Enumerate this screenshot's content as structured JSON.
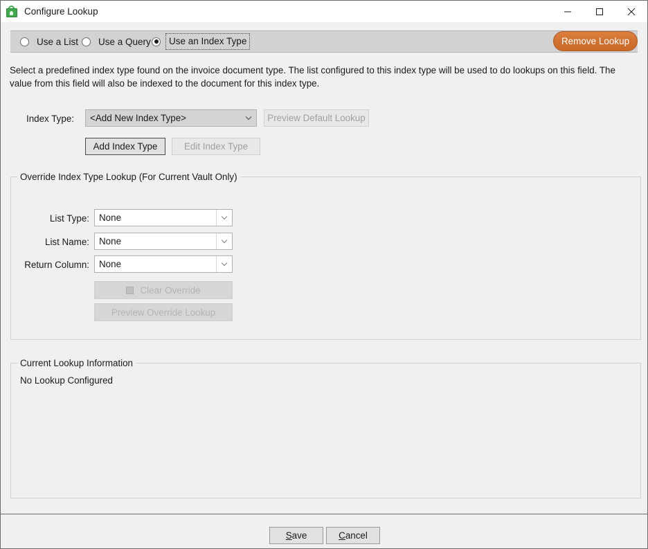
{
  "window": {
    "title": "Configure Lookup",
    "icon": "green-lock-icon",
    "controls": {
      "minimize": "minimize-icon",
      "maximize": "maximize-icon",
      "close": "close-icon"
    }
  },
  "mode_selector": {
    "options": [
      {
        "label": "Use a List",
        "selected": false,
        "focused": false
      },
      {
        "label": "Use a Query",
        "selected": false,
        "focused": false
      },
      {
        "label": "Use an Index Type",
        "selected": true,
        "focused": true
      }
    ]
  },
  "remove_lookup_button": {
    "label": "Remove Lookup",
    "color": "#d1712f",
    "text_color": "#ffffff"
  },
  "description": "Select a predefined index type found on the invoice document type. The list configured to this index type will be used to do lookups on this field. The value from this field will also be indexed to the document for this index type.",
  "index_type_section": {
    "label": "Index Type:",
    "combo_value": "<Add New Index Type>",
    "preview_button": "Preview Default Lookup",
    "add_button": "Add Index Type",
    "edit_button": "Edit Index Type"
  },
  "override_group": {
    "title": "Override Index Type Lookup (For Current Vault Only)",
    "fields": [
      {
        "label": "List Type:",
        "value": "None"
      },
      {
        "label": "List Name:",
        "value": "None"
      },
      {
        "label": "Return Column:",
        "value": "None"
      }
    ],
    "clear_button": "Clear Override",
    "preview_button": "Preview Override Lookup"
  },
  "current_lookup_group": {
    "title": "Current Lookup Information",
    "status_text": "No Lookup Configured"
  },
  "footer": {
    "save": {
      "mnemonic": "S",
      "rest": "ave"
    },
    "cancel": {
      "mnemonic": "C",
      "rest": "ancel"
    }
  }
}
